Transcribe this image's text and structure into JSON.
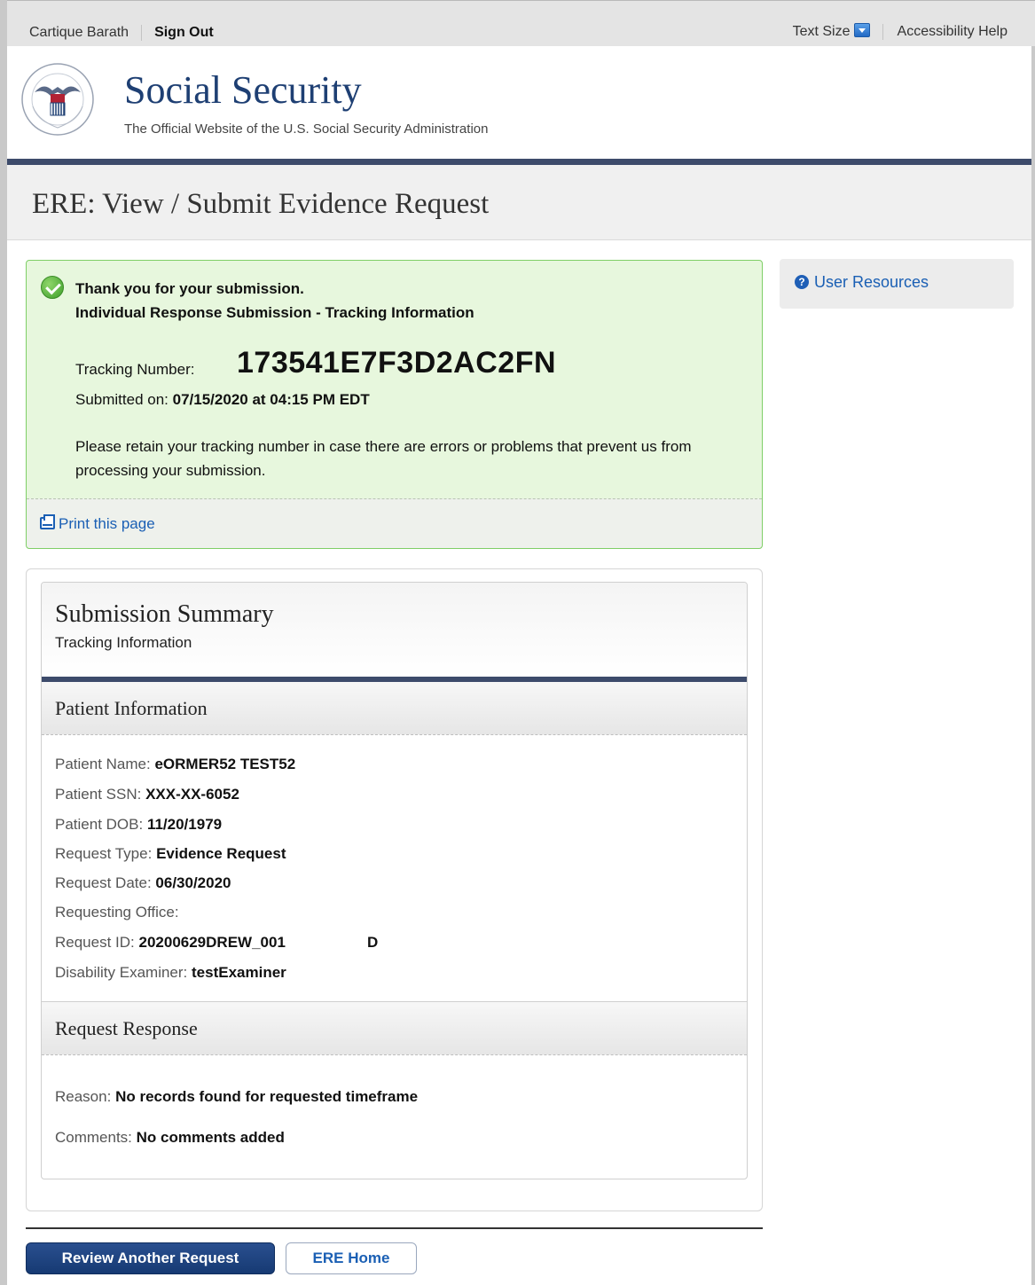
{
  "utility": {
    "user_name": "Cartique Barath",
    "sign_out": "Sign Out",
    "text_size": "Text Size",
    "accessibility_help": "Accessibility Help"
  },
  "banner": {
    "title": "Social Security",
    "subtitle": "The Official Website of the U.S. Social Security Administration"
  },
  "page_title": "ERE: View / Submit Evidence Request",
  "confirmation": {
    "heading": "Thank you for your submission.",
    "subheading": "Individual Response Submission - Tracking Information",
    "tracking_label": "Tracking Number:",
    "tracking_number": "173541E7F3D2AC2FN",
    "submitted_label": "Submitted on:",
    "submitted_value": "07/15/2020 at 04:15 PM EDT",
    "retain_notice": "Please retain your tracking number in case there are errors or problems that prevent us from processing your submission.",
    "print_link": "Print this page"
  },
  "sidebar": {
    "user_resources": "User Resources"
  },
  "summary": {
    "title": "Submission Summary",
    "subtitle": "Tracking Information",
    "patient_section": {
      "title": "Patient Information",
      "fields": [
        {
          "label": "Patient Name:",
          "value": "eORMER52 TEST52"
        },
        {
          "label": "Patient SSN:",
          "value": "XXX-XX-6052"
        },
        {
          "label": "Patient DOB:",
          "value": "11/20/1979"
        },
        {
          "label": "Request Type:",
          "value": "Evidence Request"
        },
        {
          "label": "Request Date:",
          "value": "06/30/2020"
        },
        {
          "label": "Requesting Office:",
          "value": ""
        },
        {
          "label": "Request ID:",
          "value": "20200629DREW_001",
          "suffix": "D"
        },
        {
          "label": "Disability Examiner:",
          "value": "testExaminer"
        }
      ]
    },
    "response_section": {
      "title": "Request Response",
      "fields": [
        {
          "label": "Reason:",
          "value": "No records found for requested timeframe"
        },
        {
          "label": "Comments:",
          "value": "No comments added"
        }
      ]
    }
  },
  "actions": {
    "primary": "Review Another Request",
    "secondary": "ERE Home"
  }
}
